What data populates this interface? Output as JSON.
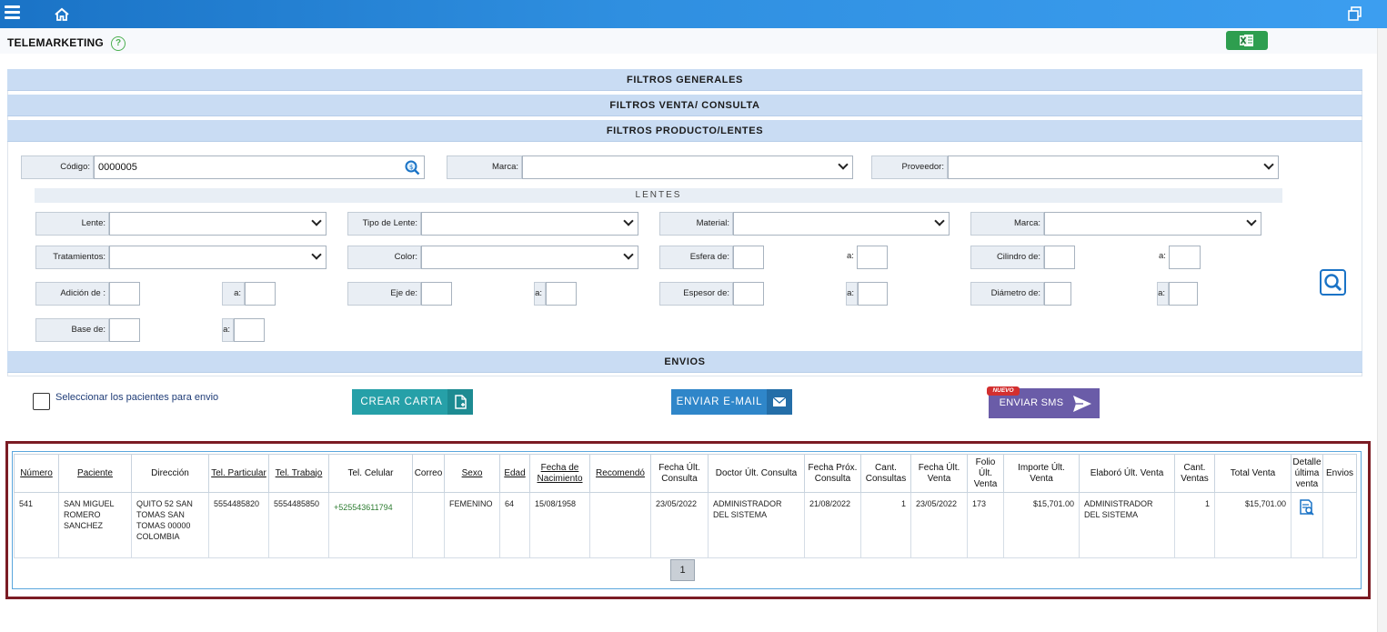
{
  "header": {
    "menu_icon": "hamburger-menu-icon",
    "home_icon": "home-icon",
    "restore_icon": "window-restore-icon"
  },
  "page": {
    "title": "TELEMARKETING",
    "help": "?",
    "excel_icon": "excel-export-icon"
  },
  "sections": {
    "generales": "FILTROS GENERALES",
    "venta": "FILTROS VENTA/ CONSULTA",
    "producto": "FILTROS PRODUCTO/LENTES",
    "envios": "ENVIOS"
  },
  "producto": {
    "codigo_label": "Código:",
    "codigo_value": "0000005",
    "marca_label": "Marca:",
    "proveedor_label": "Proveedor:"
  },
  "lentes": {
    "title": "LENTES",
    "lente_label": "Lente:",
    "tipo_label": "Tipo de Lente:",
    "material_label": "Material:",
    "marca_label": "Marca:",
    "tratamientos_label": "Tratamientos:",
    "color_label": "Color:",
    "esfera_label": "Esfera de:",
    "cilindro_label": "Cilindro de:",
    "adicion_label": "Adición de :",
    "eje_label": "Eje de:",
    "espesor_label": "Espesor de:",
    "diametro_label": "Diámetro de:",
    "base_label": "Base de:",
    "a_label": "a:"
  },
  "envios": {
    "select_label": "Seleccionar los pacientes para envio",
    "crear_carta": "CREAR CARTA",
    "enviar_email": "ENVIAR E-MAIL",
    "enviar_sms": "ENVIAR SMS",
    "nuevo_badge": "NUEVO"
  },
  "table": {
    "columns": [
      "Número",
      "Paciente",
      "Dirección",
      "Tel. Particular",
      "Tel. Trabajo",
      "Tel. Celular",
      "Correo",
      "Sexo",
      "Edad",
      "Fecha de Nacimiento",
      "Recomendó",
      "Fecha Últ. Consulta",
      "Doctor Últ. Consulta",
      "Fecha Próx. Consulta",
      "Cant. Consultas",
      "Fecha Últ. Venta",
      "Folio Últ. Venta",
      "Importe Últ. Venta",
      "Elaboró Últ. Venta",
      "Cant. Ventas",
      "Total Venta",
      "Detalle última venta",
      "Envios"
    ],
    "rows": [
      {
        "numero": "541",
        "paciente": "SAN MIGUEL ROMERO SANCHEZ",
        "direccion": "QUITO 52 SAN TOMAS SAN TOMAS 00000 COLOMBIA",
        "tel_particular": "5554485820",
        "tel_trabajo": "5554485850",
        "tel_celular": "+525543611794",
        "correo": "",
        "sexo": "FEMENINO",
        "edad": "64",
        "fecha_nacimiento": "15/08/1958",
        "recomendo": "",
        "fecha_ult_consulta": "23/05/2022",
        "doctor_ult_consulta": "ADMINISTRADOR DEL SISTEMA",
        "fecha_prox_consulta": "21/08/2022",
        "cant_consultas": "1",
        "fecha_ult_venta": "23/05/2022",
        "folio_ult_venta": "173",
        "importe_ult_venta": "$15,701.00",
        "elaboro_ult_venta": "ADMINISTRADOR DEL SISTEMA",
        "cant_ventas": "1",
        "total_venta": "$15,701.00",
        "detalle_icon": "document-search-icon",
        "envios": ""
      }
    ],
    "page": "1"
  },
  "colors": {
    "topbar": "#2f8fe0",
    "section_bar": "#c9dcf3",
    "crear_carta": "#26a0a8",
    "enviar_email": "#2f86c9",
    "enviar_sms": "#6a5ca8",
    "results_border": "#7b1c24",
    "excel": "#2e9e4f"
  }
}
